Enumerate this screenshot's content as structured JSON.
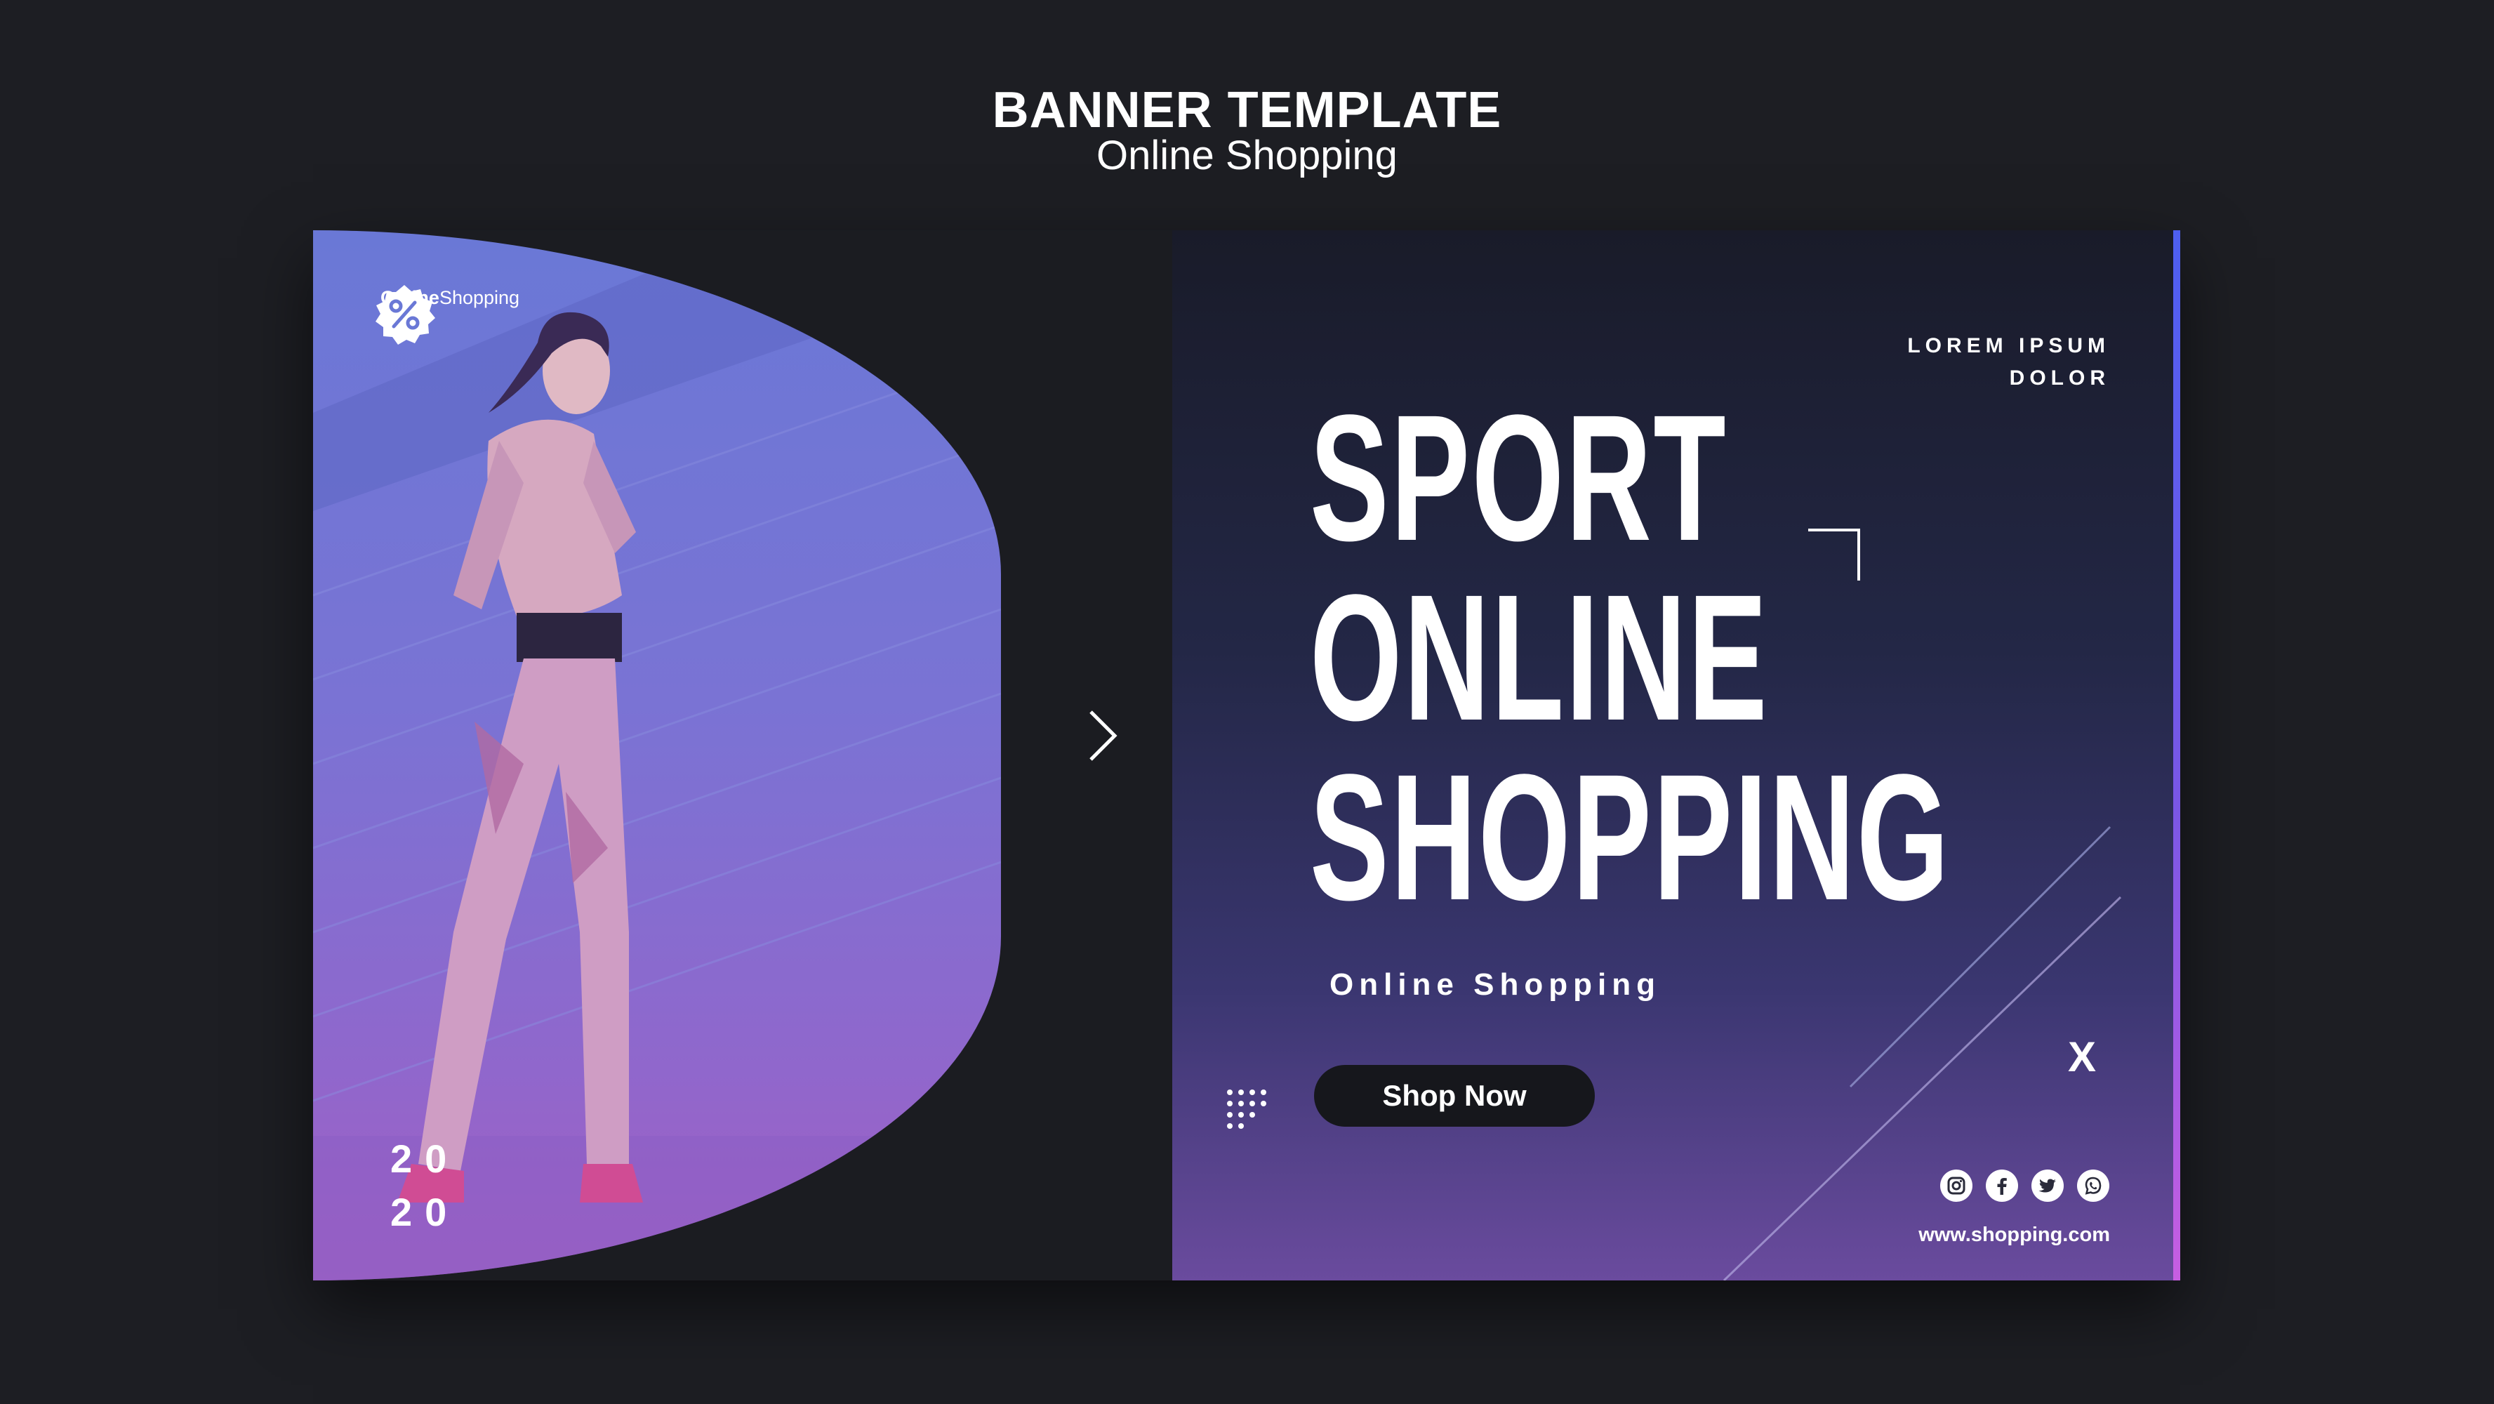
{
  "header": {
    "title": "BANNER TEMPLATE",
    "subtitle": "Online Shopping"
  },
  "banner": {
    "logo": {
      "bold": "Online",
      "regular": "Shopping",
      "icon": "percent-badge-icon"
    },
    "year": {
      "line1": "20",
      "line2": "20"
    },
    "lorem": {
      "line1": "LOREM IPSUM",
      "line2": "DOLOR"
    },
    "headline": {
      "line1": "SPORT",
      "line2": "ONLINE",
      "line3": "SHOPPING"
    },
    "tagline": "Online Shopping",
    "cta": "Shop Now",
    "close_label": "X",
    "socials": [
      "instagram-icon",
      "facebook-icon",
      "twitter-icon",
      "whatsapp-icon"
    ],
    "url": "www.shopping.com"
  },
  "colors": {
    "background": "#1d1e23",
    "panel_top": "#191b29",
    "panel_bottom": "#6a4b9e",
    "accent_blue": "#4d5ff1",
    "accent_pink": "#c75ee2",
    "photo_tint": "#7a73d4"
  }
}
